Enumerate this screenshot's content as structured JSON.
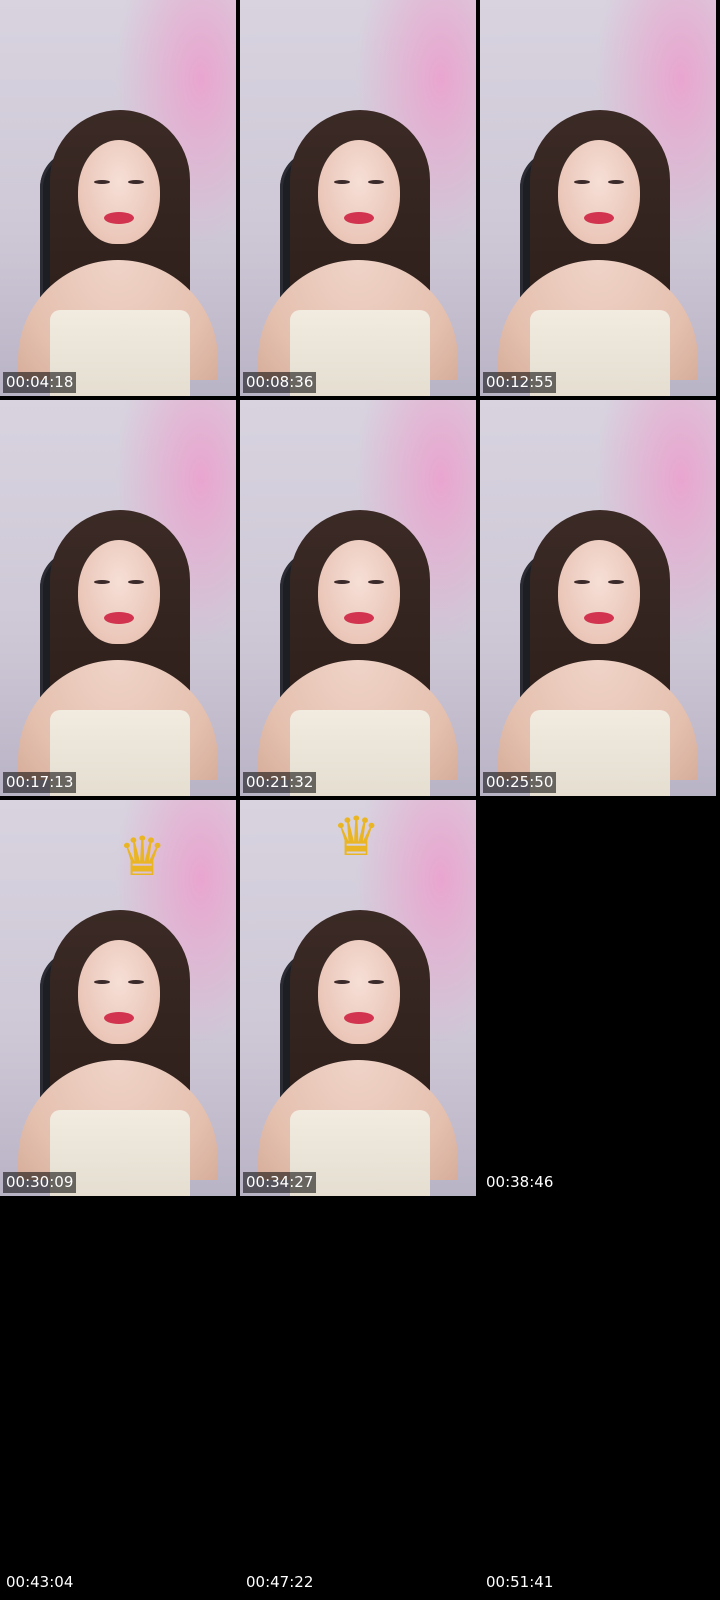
{
  "contact_sheet": {
    "frames": [
      {
        "timestamp": "00:04:18",
        "has_image": true,
        "crown": false
      },
      {
        "timestamp": "00:08:36",
        "has_image": true,
        "crown": false
      },
      {
        "timestamp": "00:12:55",
        "has_image": true,
        "crown": false
      },
      {
        "timestamp": "00:17:13",
        "has_image": true,
        "crown": false
      },
      {
        "timestamp": "00:21:32",
        "has_image": true,
        "crown": false
      },
      {
        "timestamp": "00:25:50",
        "has_image": true,
        "crown": false
      },
      {
        "timestamp": "00:30:09",
        "has_image": true,
        "crown": true
      },
      {
        "timestamp": "00:34:27",
        "has_image": true,
        "crown": true
      },
      {
        "timestamp": "00:38:46",
        "has_image": false,
        "crown": false
      },
      {
        "timestamp": "00:43:04",
        "has_image": false,
        "crown": false
      },
      {
        "timestamp": "00:47:22",
        "has_image": false,
        "crown": false
      },
      {
        "timestamp": "00:51:41",
        "has_image": false,
        "crown": false
      }
    ]
  },
  "colors": {
    "background": "#000000",
    "timestamp_text": "#ffffff",
    "crown": "#e9b522",
    "lips": "#d2334f"
  },
  "icons": {
    "crown": "crown-icon"
  }
}
